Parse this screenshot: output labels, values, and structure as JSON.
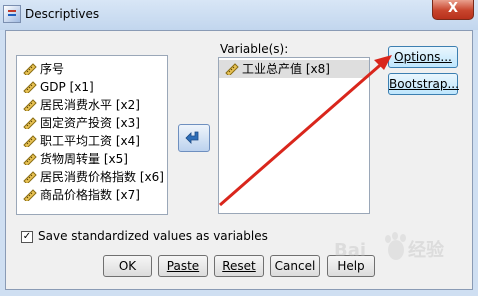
{
  "window": {
    "title": "Descriptives",
    "close_label": "X"
  },
  "source_variables": [
    {
      "label": "序号",
      "icon": "scale-ruler-icon"
    },
    {
      "label": "GDP [x1]",
      "icon": "scale-ruler-icon"
    },
    {
      "label": "居民消费水平 [x2]",
      "icon": "scale-ruler-icon"
    },
    {
      "label": "固定资产投资 [x3]",
      "icon": "scale-ruler-icon"
    },
    {
      "label": "职工平均工资 [x4]",
      "icon": "scale-ruler-icon"
    },
    {
      "label": "货物周转量 [x5]",
      "icon": "scale-ruler-icon"
    },
    {
      "label": "居民消费价格指数 [x6]",
      "icon": "scale-ruler-icon"
    },
    {
      "label": "商品价格指数 [x7]",
      "icon": "scale-ruler-icon"
    }
  ],
  "variables": {
    "label": "Variable(s):",
    "items": [
      {
        "label": "工业总产值 [x8]",
        "icon": "scale-ruler-icon"
      }
    ]
  },
  "move_button": {
    "icon": "arrow-left-icon"
  },
  "side_buttons": {
    "options": "Options...",
    "bootstrap": "Bootstrap..."
  },
  "checkbox": {
    "label": "Save standardized values as variables",
    "checked": true
  },
  "bottom_buttons": {
    "ok": "OK",
    "paste": "Paste",
    "reset": "Reset",
    "cancel": "Cancel",
    "help": "Help"
  },
  "annotation": {
    "color": "#d9261c"
  },
  "watermark": {
    "text": "Baidu 经验"
  }
}
